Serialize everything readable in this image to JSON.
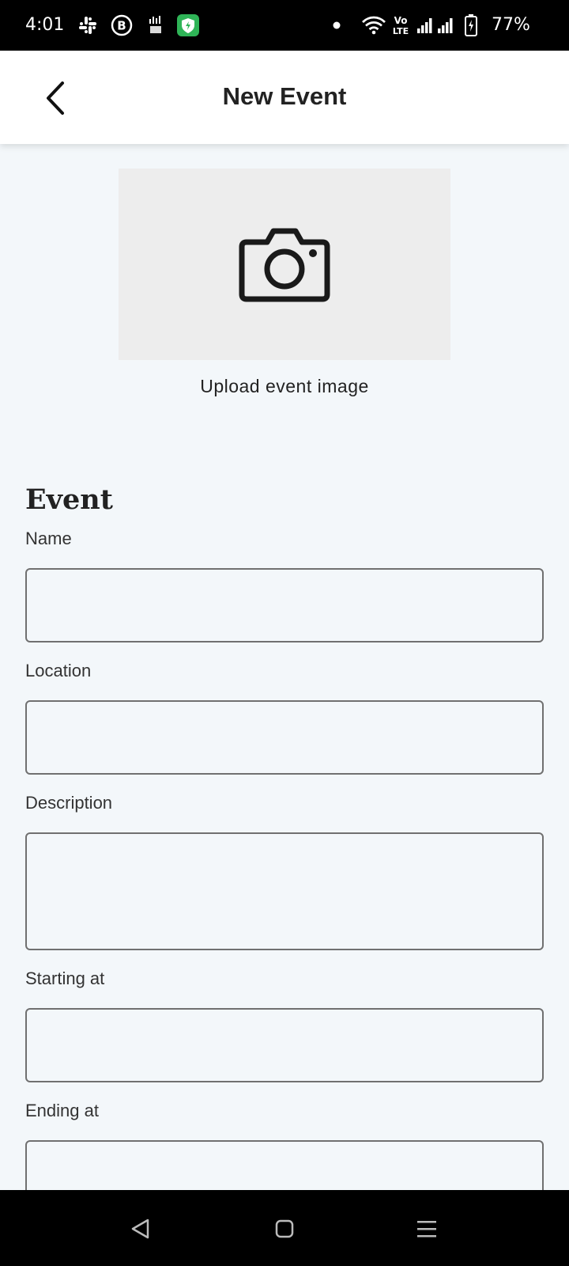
{
  "status_bar": {
    "time": "4:01",
    "battery": "77%",
    "icons": [
      "slack-icon",
      "whatsapp-business-icon",
      "carrier-icon",
      "vpn-shield-icon",
      "notification-dot-icon",
      "wifi-icon",
      "volte-icon",
      "signal-icon",
      "battery-icon"
    ]
  },
  "app_bar": {
    "title": "New Event",
    "back_icon": "chevron-left-icon"
  },
  "image_upload": {
    "icon": "camera-icon",
    "label": "Upload event image"
  },
  "form": {
    "section_title": "Event",
    "fields": [
      {
        "label": "Name",
        "value": ""
      },
      {
        "label": "Location",
        "value": ""
      },
      {
        "label": "Description",
        "value": ""
      },
      {
        "label": "Starting at",
        "value": ""
      },
      {
        "label": "Ending at",
        "value": ""
      }
    ]
  },
  "nav_bar": {
    "icons": [
      "back-triangle-icon",
      "home-square-icon",
      "recents-menu-icon"
    ]
  }
}
